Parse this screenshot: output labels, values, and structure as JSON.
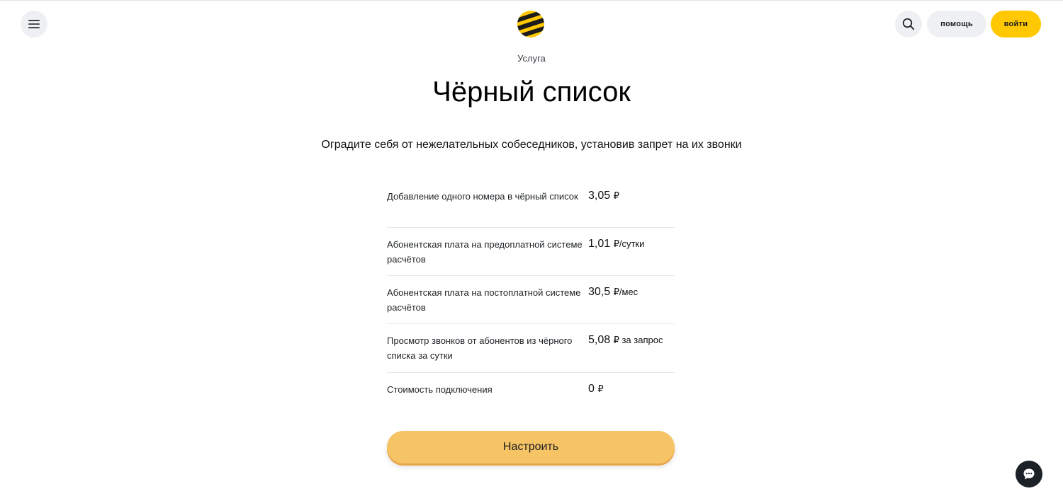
{
  "header": {
    "help_label": "помощь",
    "login_label": "войти",
    "accent_color": "#ffc800"
  },
  "page": {
    "eyebrow": "Услуга",
    "title": "Чёрный список",
    "subtitle": "Оградите себя от нежелательных собеседников, установив запрет на их звонки"
  },
  "tariffs": [
    {
      "label": "Добавление одного номера в чёрный список",
      "value": "3,05",
      "unit": "₽"
    },
    {
      "label": "Абонентская плата на предоплатной системе расчётов",
      "value": "1,01",
      "unit": "₽/сутки"
    },
    {
      "label": "Абонентская плата на постоплатной системе расчётов",
      "value": "30,5",
      "unit": "₽/мес"
    },
    {
      "label": "Просмотр звонков от абонентов из чёрного списка за сутки",
      "value": "5,08",
      "unit": "₽ за запрос"
    },
    {
      "label": "Стоимость подключения",
      "value": "0",
      "unit": "₽"
    }
  ],
  "cta": {
    "label": "Настроить",
    "color": "#f6c365"
  },
  "icons": {
    "menu": "hamburger-menu-icon",
    "logo": "beeline-logo-icon",
    "search": "search-icon",
    "chat": "chat-bubble-icon"
  }
}
